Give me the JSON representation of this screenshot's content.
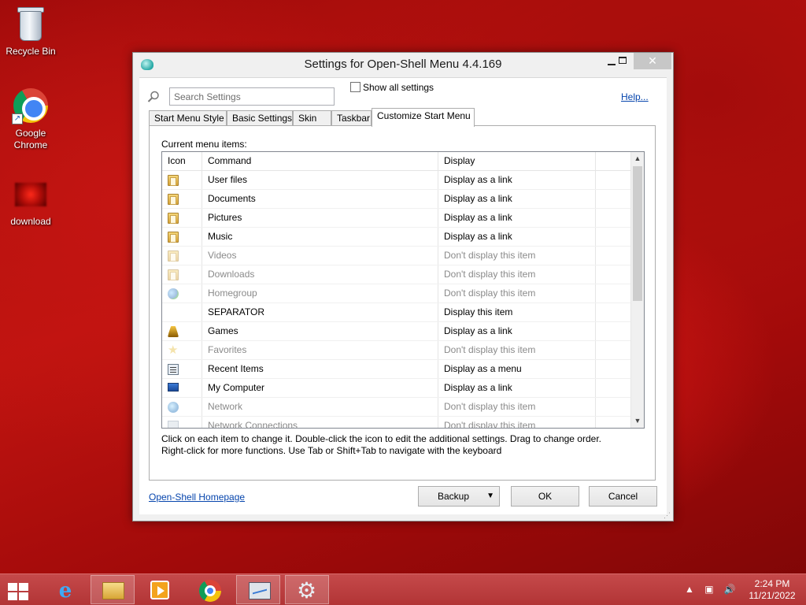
{
  "desktop": {
    "icons": [
      {
        "label": "Recycle Bin",
        "icon": "recycle-bin-icon"
      },
      {
        "label": "Google\nChrome",
        "icon": "chrome-icon"
      },
      {
        "label": "download",
        "icon": "image-file-icon"
      }
    ]
  },
  "window": {
    "title": "Settings for Open-Shell Menu 4.4.169",
    "search_placeholder": "Search Settings",
    "show_all_label": "Show all settings",
    "show_all_checked": false,
    "help_label": "Help...",
    "tabs": [
      {
        "label": "Start Menu Style",
        "active": false
      },
      {
        "label": "Basic Settings",
        "active": false
      },
      {
        "label": "Skin",
        "active": false
      },
      {
        "label": "Taskbar",
        "active": false
      },
      {
        "label": "Customize Start Menu",
        "active": true
      }
    ],
    "panel_label": "Current menu items:",
    "columns": {
      "icon": "Icon",
      "command": "Command",
      "display": "Display"
    },
    "rows": [
      {
        "icon": "user-files-folder-icon",
        "command": "User files",
        "display": "Display as a link",
        "dim": false
      },
      {
        "icon": "documents-folder-icon",
        "command": "Documents",
        "display": "Display as a link",
        "dim": false
      },
      {
        "icon": "pictures-folder-icon",
        "command": "Pictures",
        "display": "Display as a link",
        "dim": false
      },
      {
        "icon": "music-folder-icon",
        "command": "Music",
        "display": "Display as a link",
        "dim": false
      },
      {
        "icon": "videos-folder-icon",
        "command": "Videos",
        "display": "Don't display this item",
        "dim": true
      },
      {
        "icon": "downloads-folder-icon",
        "command": "Downloads",
        "display": "Don't display this item",
        "dim": true
      },
      {
        "icon": "homegroup-icon",
        "command": "Homegroup",
        "display": "Don't display this item",
        "dim": true
      },
      {
        "icon": "",
        "command": "SEPARATOR",
        "display": "Display this item",
        "dim": false
      },
      {
        "icon": "games-icon",
        "command": "Games",
        "display": "Display as a link",
        "dim": false
      },
      {
        "icon": "star-icon",
        "command": "Favorites",
        "display": "Don't display this item",
        "dim": true
      },
      {
        "icon": "recent-items-icon",
        "command": "Recent Items",
        "display": "Display as a menu",
        "dim": false
      },
      {
        "icon": "computer-icon",
        "command": "My Computer",
        "display": "Display as a link",
        "dim": false
      },
      {
        "icon": "network-icon",
        "command": "Network",
        "display": "Don't display this item",
        "dim": true
      },
      {
        "icon": "network-connections-icon",
        "command": "Network Connections",
        "display": "Don't display this item",
        "dim": true
      }
    ],
    "hint_line1": "Click on each item to change it. Double-click the icon to edit the additional settings. Drag to change order.",
    "hint_line2": "Right-click for more functions. Use Tab or Shift+Tab to navigate with the keyboard",
    "homepage_link": "Open-Shell Homepage",
    "buttons": {
      "backup": "Backup",
      "ok": "OK",
      "cancel": "Cancel"
    }
  },
  "taskbar": {
    "items": [
      "start-icon",
      "internet-explorer-icon",
      "file-explorer-icon",
      "media-player-icon",
      "chrome-icon",
      "performance-monitor-icon",
      "settings-gear-icon"
    ],
    "time": "2:24 PM",
    "date": "11/21/2022"
  },
  "colors": {
    "accent_link": "#0645ad",
    "taskbar": "#b23536",
    "wallpaper": "#c01410"
  }
}
